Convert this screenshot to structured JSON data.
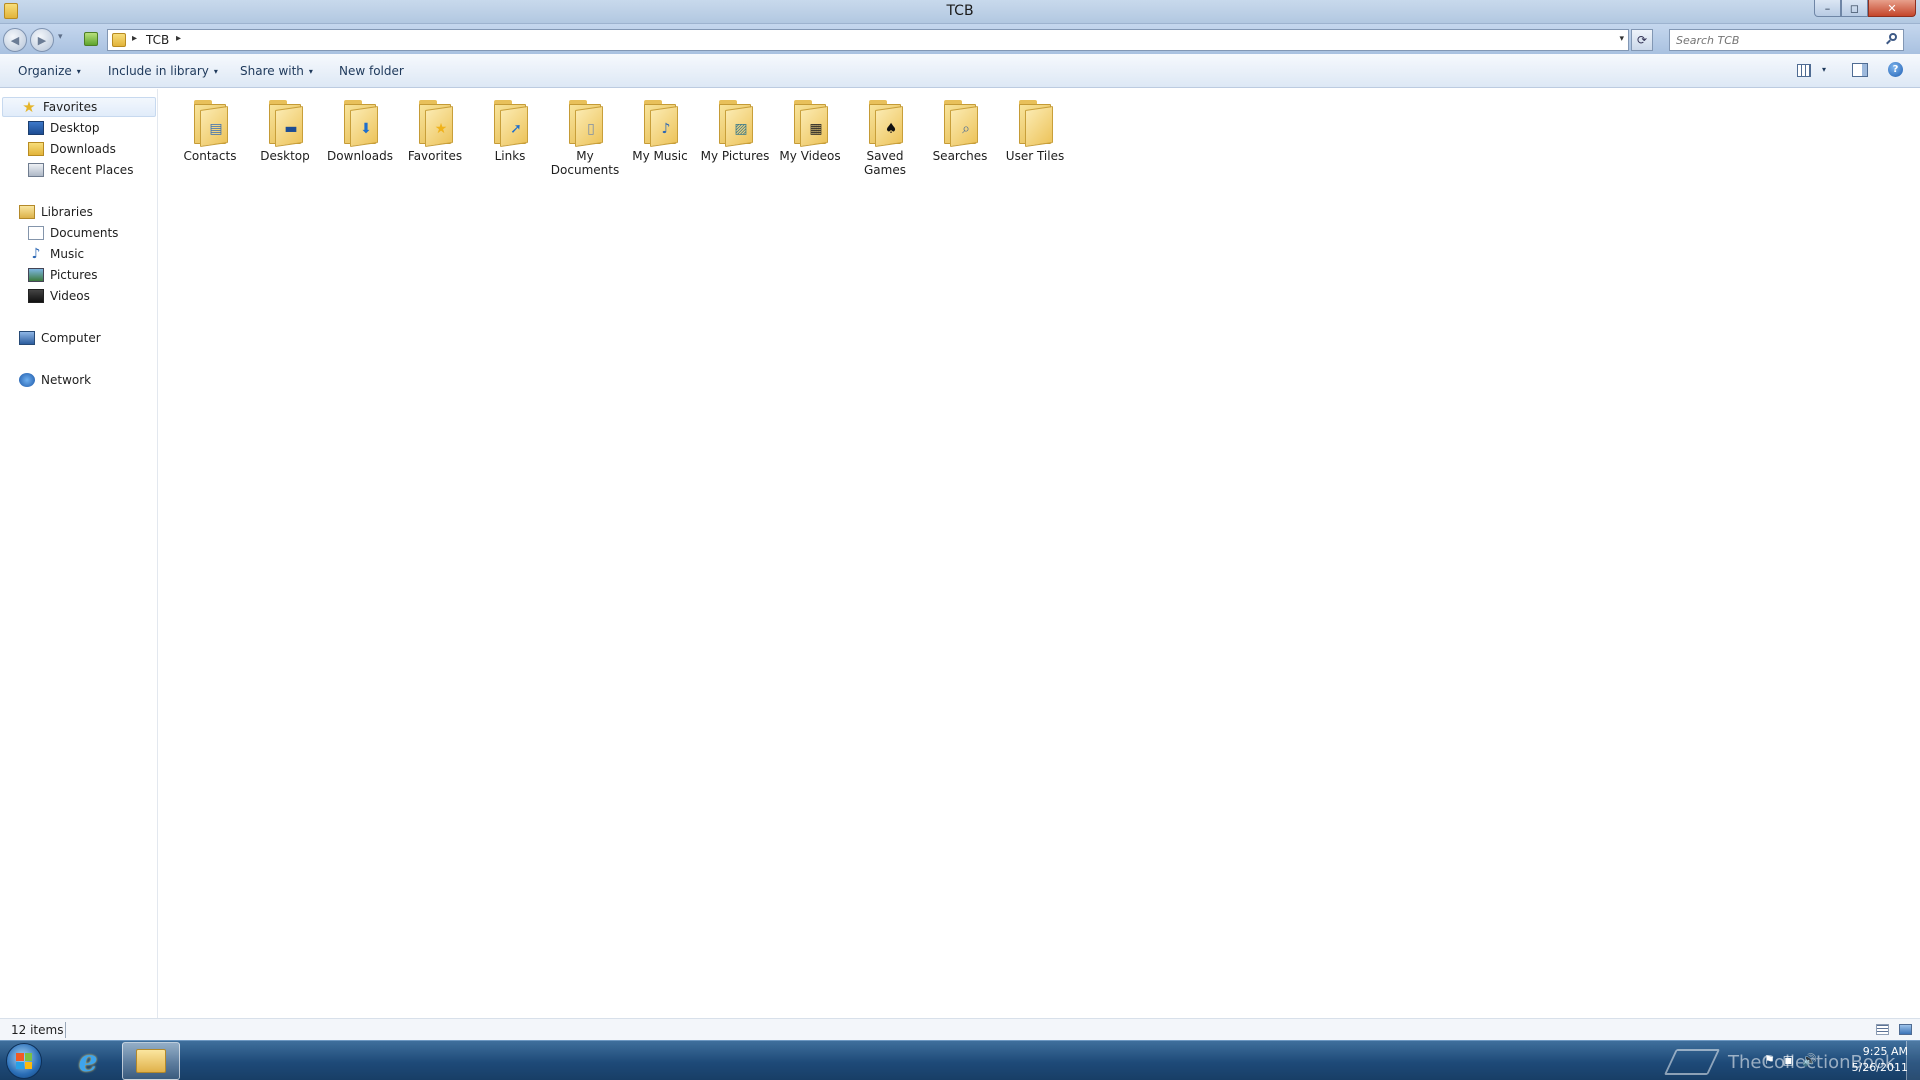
{
  "window": {
    "title": "TCB",
    "minimize_glyph": "–",
    "maximize_glyph": "◻",
    "close_glyph": "✕"
  },
  "navigation": {
    "back_glyph": "◀",
    "forward_glyph": "▶",
    "recent_glyph": "▾",
    "address": {
      "separator": "▸",
      "crumbs": [
        "TCB"
      ],
      "dropdown_glyph": "▾"
    },
    "refresh_glyph": "⟳",
    "search": {
      "placeholder": "Search TCB"
    }
  },
  "command_bar": {
    "organize": "Organize",
    "include_in_library": "Include in library",
    "share_with": "Share with",
    "new_folder": "New folder",
    "arrow_glyph": "▾",
    "help_glyph": "?"
  },
  "nav_pane": {
    "favorites": {
      "label": "Favorites",
      "icon": "star-icon",
      "items": [
        {
          "label": "Desktop",
          "icon": "desktop-icon"
        },
        {
          "label": "Downloads",
          "icon": "downloads-icon"
        },
        {
          "label": "Recent Places",
          "icon": "recent-places-icon"
        }
      ]
    },
    "libraries": {
      "label": "Libraries",
      "icon": "library-icon",
      "items": [
        {
          "label": "Documents",
          "icon": "document-icon"
        },
        {
          "label": "Music",
          "icon": "music-icon"
        },
        {
          "label": "Pictures",
          "icon": "pictures-icon"
        },
        {
          "label": "Videos",
          "icon": "videos-icon"
        }
      ]
    },
    "computer": {
      "label": "Computer",
      "icon": "computer-icon"
    },
    "network": {
      "label": "Network",
      "icon": "network-icon"
    }
  },
  "content": {
    "folders": [
      {
        "line1": "Contacts",
        "line2": "",
        "icon": "contacts-folder-icon",
        "emblem": "▤"
      },
      {
        "line1": "Desktop",
        "line2": "",
        "icon": "desktop-folder-icon",
        "emblem": "▬"
      },
      {
        "line1": "Downloads",
        "line2": "",
        "icon": "downloads-folder-icon",
        "emblem": "⬇"
      },
      {
        "line1": "Favorites",
        "line2": "",
        "icon": "favorites-folder-icon",
        "emblem": "★"
      },
      {
        "line1": "Links",
        "line2": "",
        "icon": "links-folder-icon",
        "emblem": "➚"
      },
      {
        "line1": "My",
        "line2": "Documents",
        "icon": "documents-folder-icon",
        "emblem": "▯"
      },
      {
        "line1": "My Music",
        "line2": "",
        "icon": "music-folder-icon",
        "emblem": "♪"
      },
      {
        "line1": "My Pictures",
        "line2": "",
        "icon": "pictures-folder-icon",
        "emblem": "▨"
      },
      {
        "line1": "My Videos",
        "line2": "",
        "icon": "videos-folder-icon",
        "emblem": "▦"
      },
      {
        "line1": "Saved",
        "line2": "Games",
        "icon": "saved-games-folder-icon",
        "emblem": "♠"
      },
      {
        "line1": "Searches",
        "line2": "",
        "icon": "searches-folder-icon",
        "emblem": "⌕"
      },
      {
        "line1": "User Tiles",
        "line2": "",
        "icon": "user-tiles-folder-icon",
        "emblem": ""
      }
    ]
  },
  "status_bar": {
    "item_count": "12 items"
  },
  "taskbar": {
    "ie_glyph": "e",
    "watermark": "TheCollectionBook",
    "tray_icons": [
      "flag-icon",
      "network-tray-icon",
      "volume-icon"
    ],
    "tray_glyphs": [
      "⚑",
      "▣",
      "🔊"
    ],
    "time": "9:25 AM",
    "date": "5/26/2011"
  },
  "colors": {
    "title_bar": "#b2c8e1",
    "command_text": "#1e395b",
    "folder_yellow": "#e5b84a",
    "taskbar": "#1e4a78",
    "close_button": "#c5452a"
  }
}
